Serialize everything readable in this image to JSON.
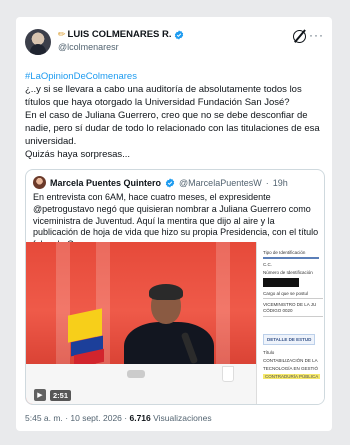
{
  "author": {
    "name": "LUIS COLMENARES R.",
    "handle": "@lcolmenaresr"
  },
  "tweet": {
    "hashtag": "#LaOpinionDeColmenares",
    "body": "¿..y si se llevara a cabo una auditoría de absolutamente todos los títulos que haya otorgado la Universidad Fundación San José?\nEn el caso de Juliana Guerrero, creo que no se debe desconfiar de nadie, pero sí dudar de todo lo relacionado con las titulaciones de esa universidad.\nQuizás haya sorpresas..."
  },
  "quote": {
    "name": "Marcela Puentes Quintero",
    "handle": "@MarcelaPuentesW",
    "age": "19h",
    "text": "En entrevista con 6AM, hace cuatro meses, el expresidente @petrogustavo negó que quisieran nombrar a Juliana Guerrero como viceministra de Juventud. Aquí la mentira que dijo al aire y la publicación de hoja de vida que hizo su propia Presidencia, con el título falso de Guerrero."
  },
  "video": {
    "time": "2:51"
  },
  "document": {
    "l1": "Tipo de Identificación",
    "l2": "C.C.",
    "l3": "Número de Identificación",
    "l4": "Cargo al que se postul",
    "l5": "VICEMINISTRO DE LA JU",
    "l6": "CÓDIGO 0020",
    "detail": "DETALLE DE ESTUD",
    "l7": "Título",
    "l8": "CONTABILIZACIÓN DE LA",
    "l9": "TECNOLOGÍA EN GESTIÓ",
    "l10": "CONTRADURÍA PÚBLICA"
  },
  "footer": {
    "time": "5:45 a. m.",
    "date": "10 sept. 2026",
    "views": "6.716",
    "views_label": "Visualizaciones"
  },
  "colors": {
    "link": "#1d9bf0",
    "verified": "#1d9bf0",
    "secondary": "#536471"
  },
  "icons": [
    "pencil-icon",
    "verified-badge-icon",
    "grok-icon",
    "more-icon",
    "play-icon"
  ]
}
